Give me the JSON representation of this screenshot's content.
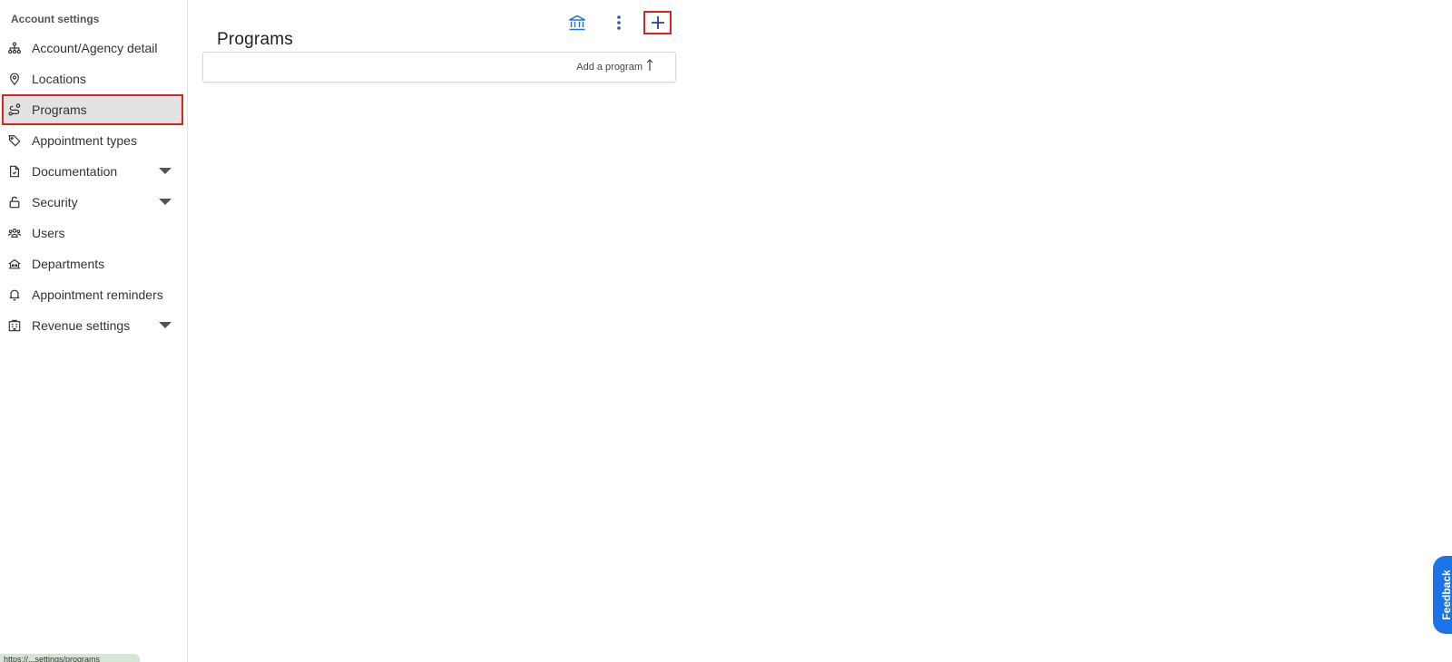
{
  "sidebar": {
    "header": "Account settings",
    "items": [
      {
        "label": "Account/Agency detail",
        "icon": "sitemap-icon",
        "expandable": false,
        "active": false
      },
      {
        "label": "Locations",
        "icon": "map-pin-icon",
        "expandable": false,
        "active": false
      },
      {
        "label": "Programs",
        "icon": "route-icon",
        "expandable": false,
        "active": true
      },
      {
        "label": "Appointment types",
        "icon": "tag-icon",
        "expandable": false,
        "active": false
      },
      {
        "label": "Documentation",
        "icon": "document-icon",
        "expandable": true,
        "active": false
      },
      {
        "label": "Security",
        "icon": "lock-icon",
        "expandable": true,
        "active": false
      },
      {
        "label": "Users",
        "icon": "users-icon",
        "expandable": false,
        "active": false
      },
      {
        "label": "Departments",
        "icon": "department-icon",
        "expandable": false,
        "active": false
      },
      {
        "label": "Appointment reminders",
        "icon": "bell-icon",
        "expandable": false,
        "active": false
      },
      {
        "label": "Revenue settings",
        "icon": "building-icon",
        "expandable": true,
        "active": false
      }
    ],
    "status_url": "https://...settings/programs"
  },
  "main": {
    "title": "Programs",
    "add_program_label": "Add a program"
  },
  "feedback": {
    "label": "Feedback"
  },
  "colors": {
    "accent": "#1b73e8",
    "highlight": "#dd2222",
    "active_bg": "#e2e2e2"
  }
}
